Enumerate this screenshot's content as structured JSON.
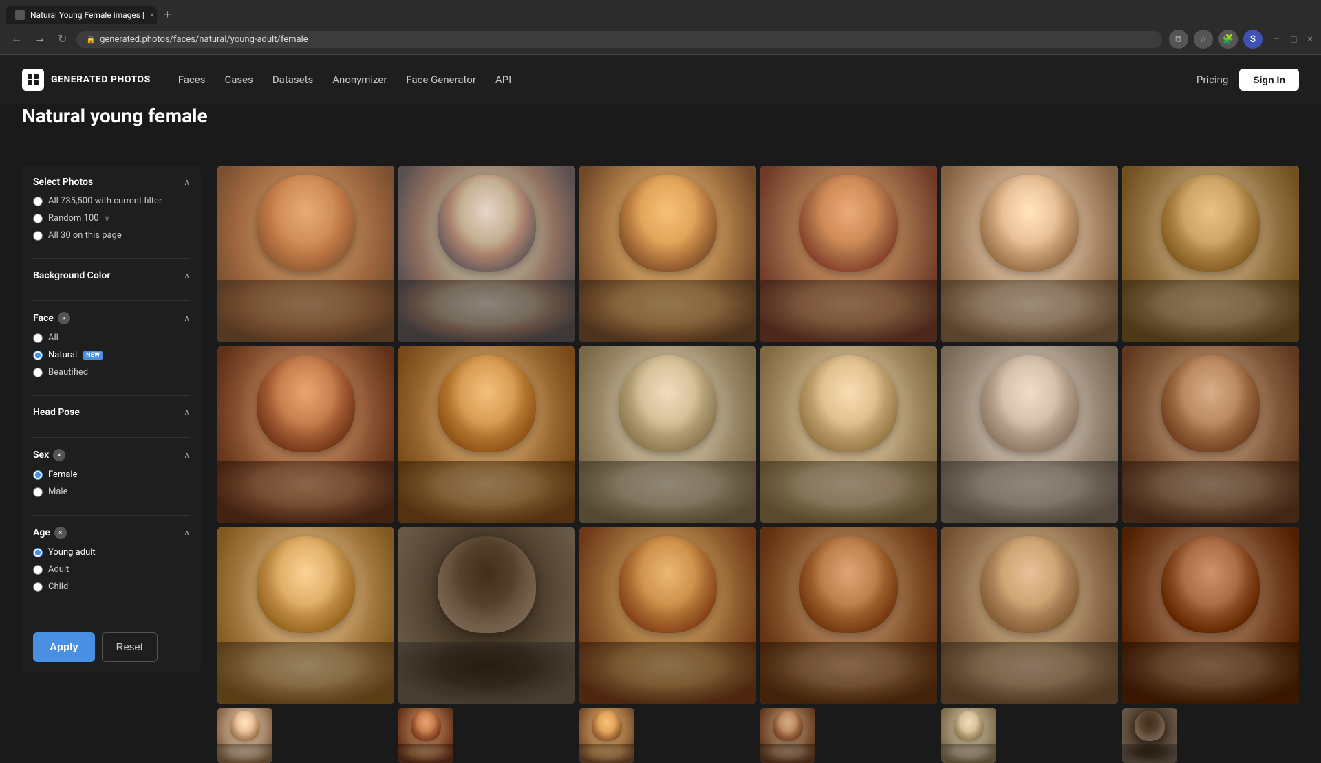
{
  "browser": {
    "tab_title": "Natural Young Female images |",
    "tab_new_label": "+",
    "url": "generated.photos/faces/natural/young-adult/female",
    "lock_icon": "🔒",
    "back_icon": "←",
    "forward_icon": "→",
    "refresh_icon": "↻",
    "extensions_icon": "⧉",
    "star_icon": "☆",
    "puzzle_icon": "🧩",
    "avatar_label": "S",
    "minimize_icon": "–",
    "maximize_icon": "□",
    "close_icon": "×",
    "window_controls": [
      "–",
      "□",
      "×"
    ]
  },
  "navbar": {
    "logo_text": "GENERATED PHOTOS",
    "nav_items": [
      {
        "label": "Faces",
        "id": "faces"
      },
      {
        "label": "Cases",
        "id": "cases"
      },
      {
        "label": "Datasets",
        "id": "datasets"
      },
      {
        "label": "Anonymizer",
        "id": "anonymizer"
      },
      {
        "label": "Face Generator",
        "id": "face-generator"
      },
      {
        "label": "API",
        "id": "api"
      }
    ],
    "pricing_label": "Pricing",
    "signin_label": "Sign In"
  },
  "page": {
    "title": "Natural young female"
  },
  "sidebar": {
    "select_photos": {
      "title": "Select Photos",
      "options": [
        {
          "id": "all",
          "label": "All 735,500 with current filter",
          "checked": false
        },
        {
          "id": "random100",
          "label": "Random 100",
          "checked": false,
          "has_chevron": true
        },
        {
          "id": "page30",
          "label": "All 30 on this page",
          "checked": false
        }
      ]
    },
    "background_color": {
      "title": "Background Color"
    },
    "face": {
      "title": "Face",
      "has_badge": true,
      "badge_label": "×",
      "options": [
        {
          "id": "all",
          "label": "All",
          "checked": false
        },
        {
          "id": "natural",
          "label": "Natural",
          "checked": true,
          "has_new": true,
          "new_label": "NEW"
        },
        {
          "id": "beautified",
          "label": "Beautified",
          "checked": false
        }
      ]
    },
    "head_pose": {
      "title": "Head Pose"
    },
    "sex": {
      "title": "Sex",
      "has_badge": true,
      "badge_label": "×",
      "options": [
        {
          "id": "female",
          "label": "Female",
          "checked": true
        },
        {
          "id": "male",
          "label": "Male",
          "checked": false
        }
      ]
    },
    "age": {
      "title": "Age",
      "has_badge": true,
      "badge_label": "×",
      "options": [
        {
          "id": "young-adult",
          "label": "Young adult",
          "checked": true
        },
        {
          "id": "adult",
          "label": "Adult",
          "checked": false
        },
        {
          "id": "child",
          "label": "Child",
          "checked": false
        }
      ]
    },
    "apply_label": "Apply",
    "reset_label": "Reset"
  },
  "photos": {
    "grid": [
      {
        "id": 1,
        "class": "p1"
      },
      {
        "id": 2,
        "class": "p2"
      },
      {
        "id": 3,
        "class": "p3"
      },
      {
        "id": 4,
        "class": "p4"
      },
      {
        "id": 5,
        "class": "p5"
      },
      {
        "id": 6,
        "class": "p6"
      },
      {
        "id": 7,
        "class": "p7"
      },
      {
        "id": 8,
        "class": "p8"
      },
      {
        "id": 9,
        "class": "p9"
      },
      {
        "id": 10,
        "class": "p10"
      },
      {
        "id": 11,
        "class": "p11"
      },
      {
        "id": 12,
        "class": "p12"
      },
      {
        "id": 13,
        "class": "p13"
      },
      {
        "id": 14,
        "class": "p14"
      },
      {
        "id": 15,
        "class": "p15"
      },
      {
        "id": 16,
        "class": "p16"
      },
      {
        "id": 17,
        "class": "p17"
      },
      {
        "id": 18,
        "class": "p18"
      }
    ]
  }
}
